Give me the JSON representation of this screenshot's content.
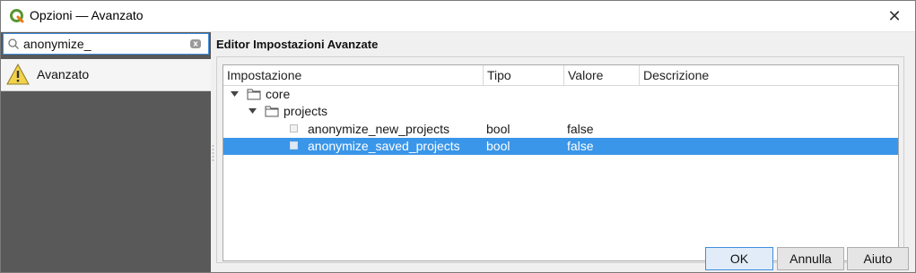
{
  "window": {
    "title": "Opzioni — Avanzato",
    "close_glyph": "✕"
  },
  "sidebar": {
    "search": {
      "value": "anonymize_",
      "placeholder": ""
    },
    "items": [
      {
        "label": "Avanzato",
        "icon": "warning-icon"
      }
    ]
  },
  "main": {
    "section_title": "Editor Impostazioni Avanzate",
    "columns": [
      "Impostazione",
      "Tipo",
      "Valore",
      "Descrizione"
    ],
    "rows": [
      {
        "name": "core",
        "type": "",
        "value": "",
        "description": "",
        "kind": "folder",
        "expanded": true,
        "level": 0
      },
      {
        "name": "projects",
        "type": "",
        "value": "",
        "description": "",
        "kind": "folder",
        "expanded": true,
        "level": 1
      },
      {
        "name": "anonymize_new_projects",
        "type": "bool",
        "value": "false",
        "description": "",
        "kind": "setting",
        "level": 2,
        "selected": false
      },
      {
        "name": "anonymize_saved_projects",
        "type": "bool",
        "value": "false",
        "description": "",
        "kind": "setting",
        "level": 2,
        "selected": true
      }
    ]
  },
  "buttons": {
    "ok": "OK",
    "cancel": "Annulla",
    "help": "Aiuto"
  },
  "colors": {
    "selection": "#3a96e8",
    "sidebar_bg": "#595959",
    "focus_border": "#3d8ee0",
    "qgis_green": "#589632"
  }
}
